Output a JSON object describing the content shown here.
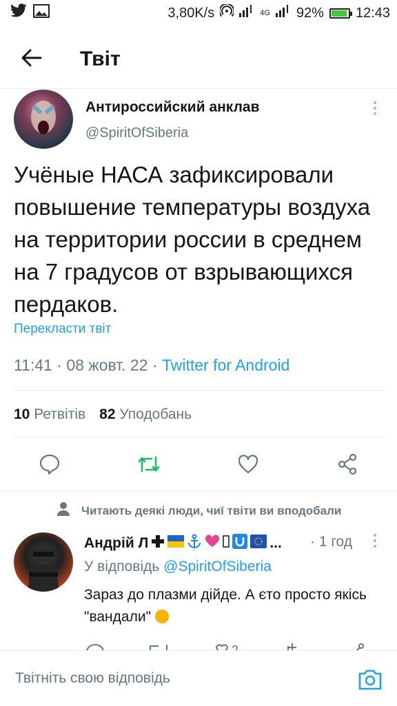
{
  "status_bar": {
    "speed": "3,80K/s",
    "network": "4G",
    "battery": "92%",
    "battery_level": 0.92,
    "time": "12:43",
    "icons": [
      "twitter-icon",
      "image-icon",
      "hotspot-icon",
      "signal-icon",
      "battery-icon"
    ]
  },
  "header": {
    "title": "Твіт",
    "back_icon": "arrow-left-icon"
  },
  "tweet": {
    "author_name": "Антироссийский анклав",
    "author_handle": "@SpiritOfSiberia",
    "text": "Учёные НАСА зафиксировали повышение температуры воздуха на территории россии в среднем на 7 градусов от взрывающихся пердаков.",
    "translate_label": "Перекласти твіт",
    "time": "11:41",
    "date": "08 жовт. 22",
    "source": "Twitter for Android",
    "retweets_count": "10",
    "retweets_label": "Ретвітів",
    "likes_count": "82",
    "likes_label": "Уподобань"
  },
  "social_context": "Читають деякі люди, чиї твіти ви вподобали",
  "reply": {
    "author_name": "Андрій Л",
    "author_suffix": "...",
    "time": "1 год",
    "reply_prefix": "У відповідь",
    "reply_handle": "@SpiritOfSiberia",
    "text": "Зараз до плазми дійде. А єто просто якісь \"вандали\"",
    "likes_partial": "2"
  },
  "compose": {
    "placeholder": "Твітніть свою відповідь"
  },
  "colors": {
    "accent": "#1da1f2",
    "secondary": "#657786",
    "retweet": "#17bf63",
    "divider": "#e6ecf0"
  }
}
